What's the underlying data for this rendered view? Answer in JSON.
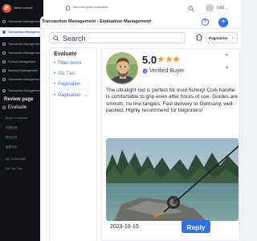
{
  "app": {
    "logo_letter": "B",
    "name": "Admin console"
  },
  "sidebar": {
    "items": [
      {
        "label": "Transaction Management"
      },
      {
        "label": "Transaction Management / Evaluation Management"
      },
      {
        "label": "Transaction Management"
      },
      {
        "label": "Transaction Management"
      },
      {
        "label": "Product Management"
      },
      {
        "label": "Merchant Management"
      },
      {
        "label": "Transaction Management"
      },
      {
        "label": "Transaction Management"
      }
    ],
    "review_page": "Review page",
    "review_sub": "Buyer's evidence",
    "evaluate_group": "Evaluate",
    "evaluate_sub_1": "品质反馈",
    "evaluate_sub_2": "售后反馈",
    "evaluate_sub_3": "客服评价",
    "evaluate_sub_4": "My Orders plain",
    "evaluate_sub_5": "Ma Tiao Tiao"
  },
  "topbar": {
    "title": "Merchant plain evaluation",
    "user": "Udd"
  },
  "page": {
    "breadcrumb": "Transaction Management - Evaluation Management",
    "search_placeholder": "Search",
    "pagination_label": "Pagination"
  },
  "filter": {
    "title": "Evaluate",
    "items": [
      {
        "label": "Filter items"
      },
      {
        "label": "Ma Tiao"
      },
      {
        "label": "Pagination"
      },
      {
        "label": "Pagination"
      }
    ]
  },
  "review": {
    "rating": "5.0",
    "star_count": 3,
    "badge": "Verified Buyer",
    "text": "The ultralight rod is perfect for trout fishing! Cork handle is comfortable to grip even after hours of use. Guides are smooth, no line tangles. Fast delivery to Germany, well-packed. Highly recommend for beginners!",
    "date": "2023-10-15",
    "reply_label": "Reply"
  },
  "colors": {
    "accent": "#2f6fe8",
    "star": "#e6a23c",
    "sidebar_bg": "#101216"
  }
}
